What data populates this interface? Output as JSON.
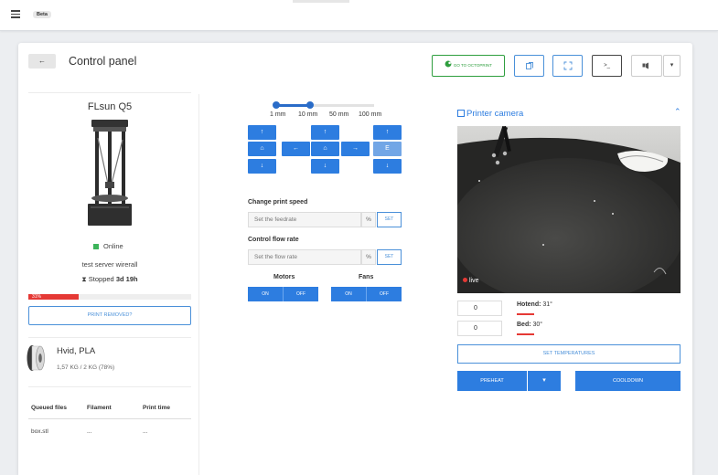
{
  "topbar": {
    "badge": "Beta"
  },
  "header": {
    "back_label": "←",
    "title": "Control panel",
    "octoprint_label": "GO TO OCTOPRINT",
    "terminal_label": ">_"
  },
  "printer": {
    "name": "FLsun Q5",
    "status": "Online",
    "status_color": "#3cb45a",
    "server": "test server wirerall",
    "stopped_prefix": "Stopped ",
    "stopped_duration": "3d 19h",
    "progress_percent": 31,
    "progress_label": "31%",
    "print_removed_label": "PRINT REMOVED?"
  },
  "filament": {
    "name": "Hvid, PLA",
    "weight": "1,57 KG / 2 KG (78%)"
  },
  "queue": {
    "headers": [
      "Queued files",
      "Filament",
      "Print time"
    ],
    "rows": [
      {
        "file": "box.stl",
        "filament": "...",
        "time": "..."
      }
    ]
  },
  "jog": {
    "step_labels": [
      "1 mm",
      "10 mm",
      "50 mm",
      "100 mm"
    ],
    "selected_step_index": 1,
    "up": "↑",
    "down": "↓",
    "left": "←",
    "right": "→",
    "home": "⌂",
    "extrude": "E"
  },
  "speed": {
    "label": "Change print speed",
    "placeholder": "Set the feedrate",
    "unit": "%",
    "set_label": "SET"
  },
  "flow": {
    "label": "Control flow rate",
    "placeholder": "Set the flow rate",
    "unit": "%",
    "set_label": "SET"
  },
  "motors": {
    "label": "Motors",
    "on": "ON",
    "off": "OFF"
  },
  "fans": {
    "label": "Fans",
    "on": "ON",
    "off": "OFF"
  },
  "camera": {
    "title": "Printer camera",
    "live_label": "live"
  },
  "temps": {
    "hotend_value": "0",
    "hotend_label": "Hotend:",
    "hotend_current": " 31°",
    "bed_value": "0",
    "bed_label": "Bed:",
    "bed_current": " 30°",
    "set_label": "SET TEMPERATURES",
    "preheat_label": "PREHEAT",
    "preheat_dropdown": "▾",
    "cooldown_label": "COOLDOWN"
  },
  "colors": {
    "accent": "#2d7de0",
    "danger": "#e53935",
    "success": "#3cb45a",
    "octoprint_green": "#2e9e3e"
  }
}
